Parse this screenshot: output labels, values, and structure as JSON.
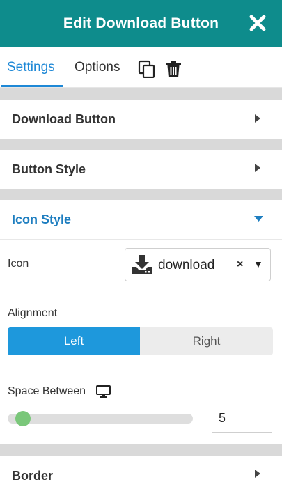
{
  "header": {
    "title": "Edit Download Button"
  },
  "tabs": [
    {
      "label": "Settings"
    },
    {
      "label": "Options"
    }
  ],
  "sections": {
    "download_button": {
      "title": "Download Button"
    },
    "button_style": {
      "title": "Button Style"
    },
    "icon_style": {
      "title": "Icon Style",
      "icon_label": "Icon",
      "icon_value": "download",
      "alignment_label": "Alignment",
      "alignment_options": [
        "Left",
        "Right"
      ],
      "alignment_selected": "Left",
      "space_between_label": "Space Between",
      "space_between_value": "5",
      "space_between_fraction": 0.0
    },
    "border": {
      "title": "Border"
    }
  },
  "colors": {
    "header": "#0e8c8c",
    "accent": "#1e88d6",
    "slider_thumb": "#7ac77a"
  },
  "icons": [
    "close-icon",
    "copy-icon",
    "trash-icon",
    "caret-right-icon",
    "caret-down-icon",
    "download-icon",
    "clear-icon",
    "desktop-icon"
  ]
}
